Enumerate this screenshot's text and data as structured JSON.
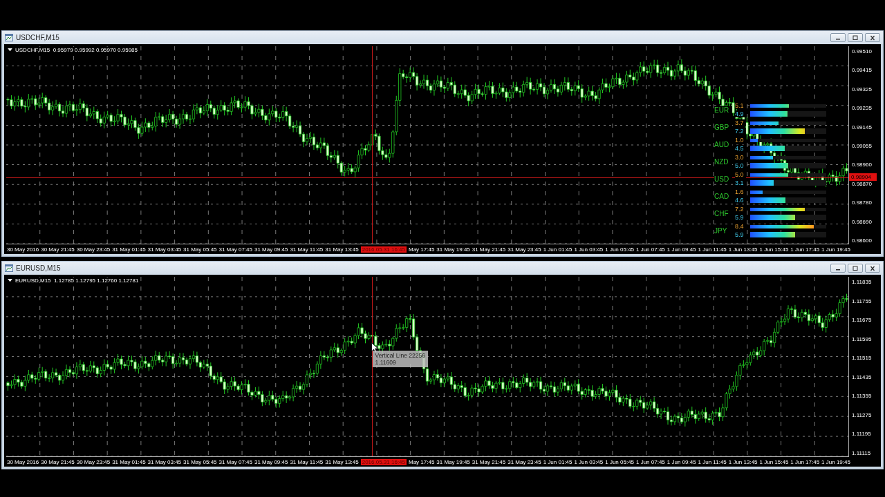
{
  "charts": [
    {
      "title": "USDCHF,M15",
      "info": "USDCHF,M15  0.95979 0.95992 0.95970 0.95985",
      "price_ticks": [
        "0.99510",
        "0.99415",
        "0.99325",
        "0.99235",
        "0.99145",
        "0.99055",
        "0.98960",
        "0.98870",
        "0.98780",
        "0.98690",
        "0.98600"
      ],
      "current_price": "0.98904",
      "time_labels": [
        {
          "kind": "tick",
          "text": "30 May 2016"
        },
        {
          "kind": "tick",
          "text": "30 May 21:45"
        },
        {
          "kind": "tick",
          "text": "30 May 23:45"
        },
        {
          "kind": "tick",
          "text": "31 May 01:45"
        },
        {
          "kind": "tick",
          "text": "31 May 03:45"
        },
        {
          "kind": "tick",
          "text": "31 May 05:45"
        },
        {
          "kind": "tick",
          "text": "31 May 07:45"
        },
        {
          "kind": "tick",
          "text": "31 May 09:45"
        },
        {
          "kind": "tick",
          "text": "31 May 11:45"
        },
        {
          "kind": "tick",
          "text": "31 May 13:45"
        },
        {
          "kind": "marker",
          "text": "2016.05.31 16:45"
        },
        {
          "kind": "tick",
          "text": "May 17:45"
        },
        {
          "kind": "tick",
          "text": "31 May 19:45"
        },
        {
          "kind": "tick",
          "text": "31 May 21:45"
        },
        {
          "kind": "tick",
          "text": "31 May 23:45"
        },
        {
          "kind": "tick",
          "text": "1 Jun 01:45"
        },
        {
          "kind": "tick",
          "text": "1 Jun 03:45"
        },
        {
          "kind": "tick",
          "text": "1 Jun 05:45"
        },
        {
          "kind": "tick",
          "text": "1 Jun 07:45"
        },
        {
          "kind": "tick",
          "text": "1 Jun 09:45"
        },
        {
          "kind": "tick",
          "text": "1 Jun 11:45"
        },
        {
          "kind": "tick",
          "text": "1 Jun 13:45"
        },
        {
          "kind": "tick",
          "text": "1 Jun 15:45"
        },
        {
          "kind": "tick",
          "text": "1 Jun 17:45"
        },
        {
          "kind": "tick",
          "text": "1 Jun 19:45"
        }
      ],
      "strength": [
        {
          "currency": "EUR",
          "bars": [
            {
              "reading": "5.1",
              "level": 0.51
            },
            {
              "reading": "4.9",
              "level": 0.49
            }
          ]
        },
        {
          "currency": "GBP",
          "bars": [
            {
              "reading": "3.7",
              "level": 0.37
            },
            {
              "reading": "7.2",
              "level": 0.72
            }
          ]
        },
        {
          "currency": "AUD",
          "bars": [
            {
              "reading": "1.0",
              "level": 0.1
            },
            {
              "reading": "4.5",
              "level": 0.45
            }
          ]
        },
        {
          "currency": "NZD",
          "bars": [
            {
              "reading": "3.0",
              "level": 0.3
            },
            {
              "reading": "5.0",
              "level": 0.5
            }
          ]
        },
        {
          "currency": "USD",
          "bars": [
            {
              "reading": "5.0",
              "level": 0.5
            },
            {
              "reading": "3.1",
              "level": 0.31
            }
          ]
        },
        {
          "currency": "CAD",
          "bars": [
            {
              "reading": "1.6",
              "level": 0.16
            },
            {
              "reading": "4.6",
              "level": 0.46
            }
          ]
        },
        {
          "currency": "CHF",
          "bars": [
            {
              "reading": "7.2",
              "level": 0.72
            },
            {
              "reading": "5.9",
              "level": 0.59
            }
          ]
        },
        {
          "currency": "JPY",
          "bars": [
            {
              "reading": "8.4",
              "level": 0.84
            },
            {
              "reading": "5.9",
              "level": 0.59
            }
          ]
        }
      ]
    },
    {
      "title": "EURUSD,M15",
      "info": "EURUSD,M15  1.12785 1.12795 1.12760 1.12781",
      "price_ticks": [
        "1.11835",
        "1.11755",
        "1.11675",
        "1.11595",
        "1.11515",
        "1.11435",
        "1.11355",
        "1.11275",
        "1.11195",
        "1.11115"
      ],
      "time_labels": [
        {
          "kind": "tick",
          "text": "30 May 2016"
        },
        {
          "kind": "tick",
          "text": "30 May 21:45"
        },
        {
          "kind": "tick",
          "text": "30 May 23:45"
        },
        {
          "kind": "tick",
          "text": "31 May 01:45"
        },
        {
          "kind": "tick",
          "text": "31 May 03:45"
        },
        {
          "kind": "tick",
          "text": "31 May 05:45"
        },
        {
          "kind": "tick",
          "text": "31 May 07:45"
        },
        {
          "kind": "tick",
          "text": "31 May 09:45"
        },
        {
          "kind": "tick",
          "text": "31 May 11:45"
        },
        {
          "kind": "tick",
          "text": "31 May 13:45"
        },
        {
          "kind": "marker",
          "text": "2016.05.31 16:45"
        },
        {
          "kind": "tick",
          "text": "May 17:45"
        },
        {
          "kind": "tick",
          "text": "31 May 19:45"
        },
        {
          "kind": "tick",
          "text": "31 May 21:45"
        },
        {
          "kind": "tick",
          "text": "31 May 23:45"
        },
        {
          "kind": "tick",
          "text": "1 Jun 01:45"
        },
        {
          "kind": "tick",
          "text": "1 Jun 03:45"
        },
        {
          "kind": "tick",
          "text": "1 Jun 05:45"
        },
        {
          "kind": "tick",
          "text": "1 Jun 07:45"
        },
        {
          "kind": "tick",
          "text": "1 Jun 09:45"
        },
        {
          "kind": "tick",
          "text": "1 Jun 11:45"
        },
        {
          "kind": "tick",
          "text": "1 Jun 13:45"
        },
        {
          "kind": "tick",
          "text": "1 Jun 15:45"
        },
        {
          "kind": "tick",
          "text": "1 Jun 17:45"
        },
        {
          "kind": "tick",
          "text": "1 Jun 19:45"
        }
      ],
      "tooltip": {
        "title": "Vertical Line 22256",
        "value": "1.11609"
      }
    }
  ]
}
